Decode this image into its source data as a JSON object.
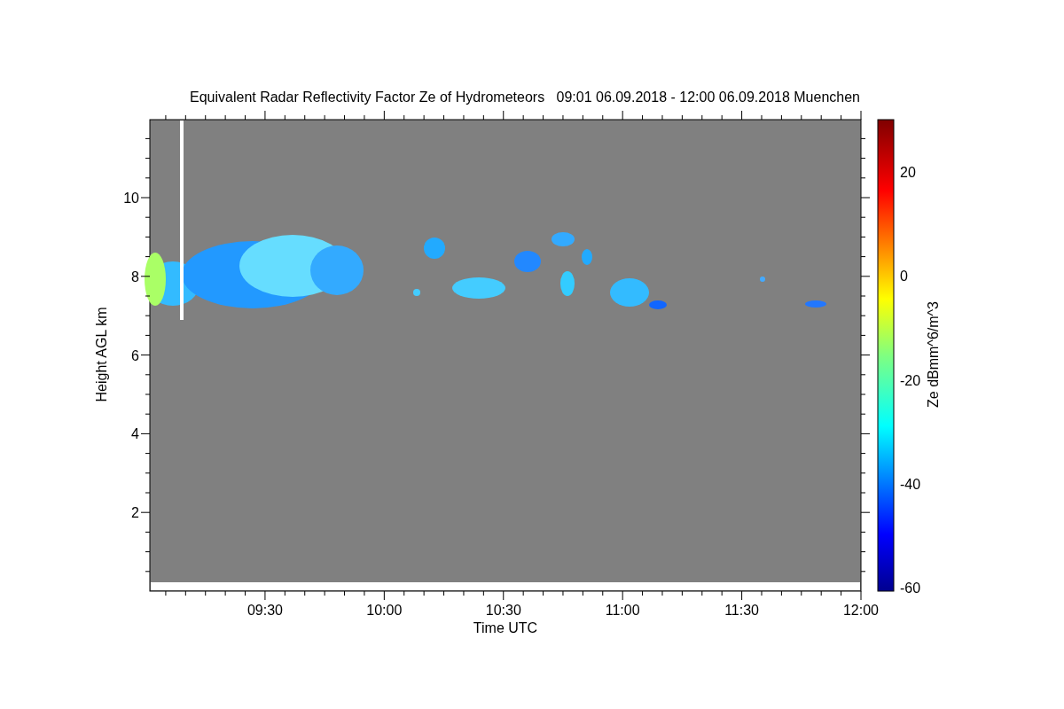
{
  "title": "Equivalent Radar Reflectivity Factor Ze of Hydrometeors   09:01 06.09.2018 - 12:00 06.09.2018 Muenchen",
  "plot": {
    "xlabel": "Time UTC",
    "ylabel": "Height AGL km",
    "xticks": [
      "09:30",
      "10:00",
      "10:30",
      "11:00",
      "11:30",
      "12:00"
    ],
    "yticks": [
      "10",
      "8",
      "6",
      "4",
      "2"
    ]
  },
  "colorbar": {
    "label": "Ze dBmm^6/m^3",
    "ticks": [
      "20",
      "0",
      "-20",
      "-40",
      "-60"
    ]
  }
}
